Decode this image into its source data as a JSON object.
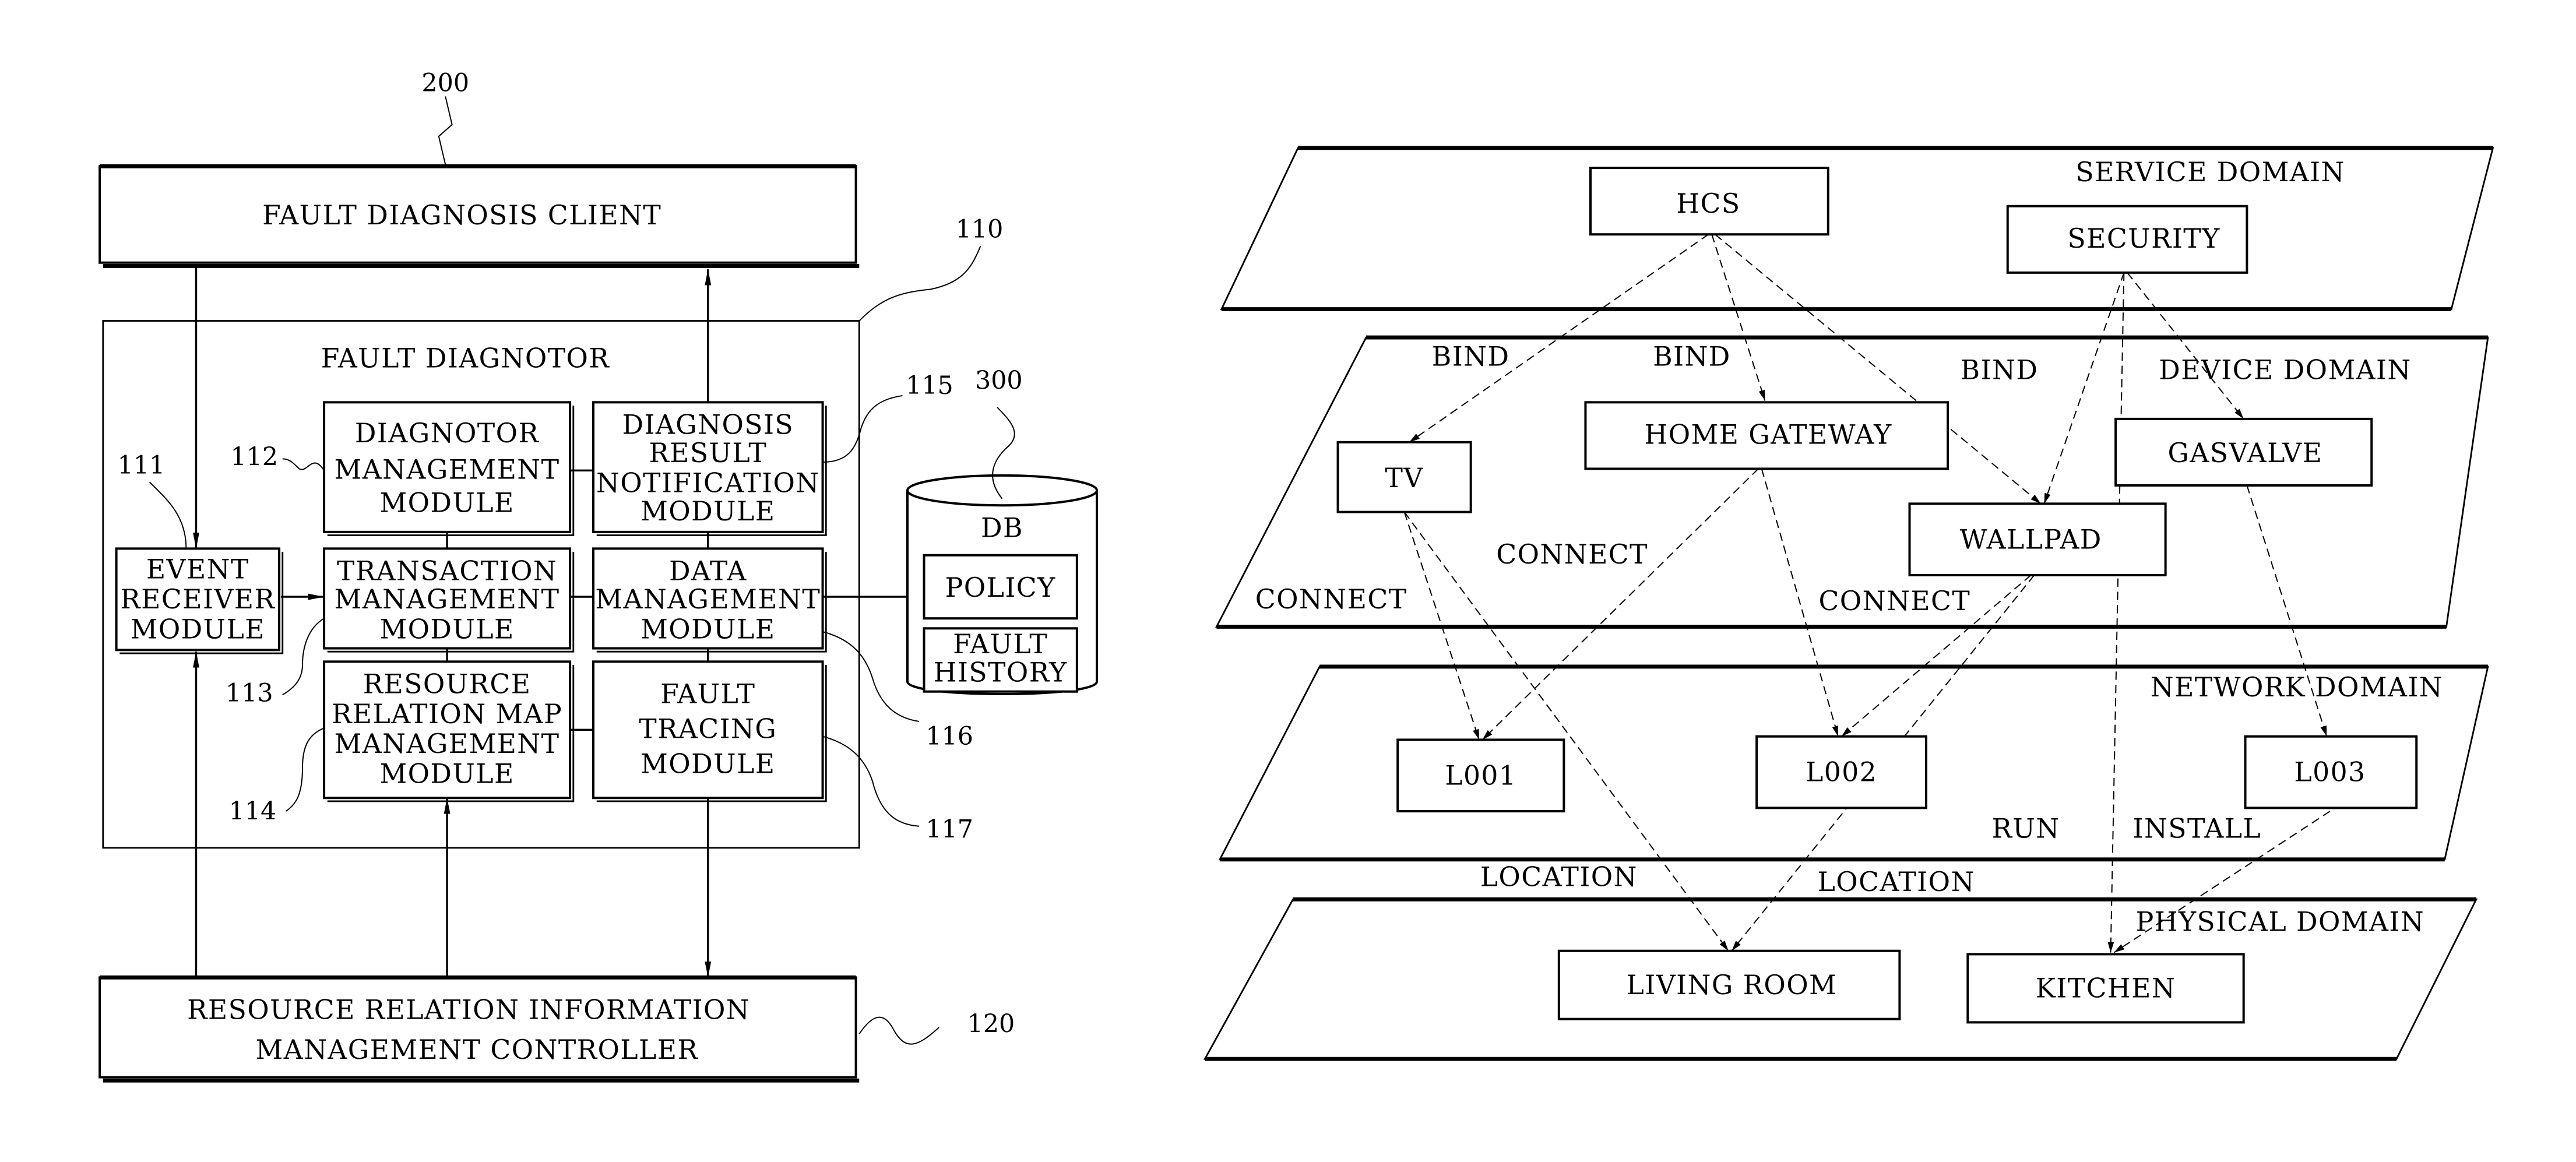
{
  "left_diagram": {
    "client": {
      "label": "FAULT DIAGNOSIS CLIENT",
      "ref": "200"
    },
    "diagnotor": {
      "label": "FAULT DIAGNOTOR",
      "ref": "110"
    },
    "modules": {
      "event_receiver": {
        "lines": [
          "EVENT",
          "RECEIVER",
          "MODULE"
        ],
        "ref": "111"
      },
      "diagnotor_management": {
        "lines": [
          "DIAGNOTOR",
          "MANAGEMENT",
          "MODULE"
        ],
        "ref": "112"
      },
      "transaction_management": {
        "lines": [
          "TRANSACTION",
          "MANAGEMENT",
          "MODULE"
        ],
        "ref": "113"
      },
      "resource_relation_map": {
        "lines": [
          "RESOURCE",
          "RELATION MAP",
          "MANAGEMENT",
          "MODULE"
        ],
        "ref": "114"
      },
      "diagnosis_result_notification": {
        "lines": [
          "DIAGNOSIS",
          "RESULT",
          "NOTIFICATION",
          "MODULE"
        ],
        "ref": "115"
      },
      "data_management": {
        "lines": [
          "DATA",
          "MANAGEMENT",
          "MODULE"
        ],
        "ref": "116"
      },
      "fault_tracing": {
        "lines": [
          "FAULT",
          "TRACING",
          "MODULE"
        ],
        "ref": "117"
      }
    },
    "db": {
      "label": "DB",
      "ref": "300",
      "policy": "POLICY",
      "fault_history": [
        "FAULT",
        "HISTORY"
      ]
    },
    "controller": {
      "lines": [
        "RESOURCE RELATION INFORMATION",
        "MANAGEMENT CONTROLLER"
      ],
      "ref": "120"
    }
  },
  "right_diagram": {
    "domains": {
      "service": "SERVICE DOMAIN",
      "device": "DEVICE DOMAIN",
      "network": "NETWORK DOMAIN",
      "physical": "PHYSICAL DOMAIN"
    },
    "nodes": {
      "hcs": "HCS",
      "security": "SECURITY",
      "tv": "TV",
      "home_gateway": "HOME GATEWAY",
      "gasvalve": "GASVALVE",
      "wallpad": "WALLPAD",
      "l001": "L001",
      "l002": "L002",
      "l003": "L003",
      "living_room": "LIVING ROOM",
      "kitchen": "KITCHEN"
    },
    "relations": {
      "bind1": "BIND",
      "bind2": "BIND",
      "bind3": "BIND",
      "connect1": "CONNECT",
      "connect2": "CONNECT",
      "connect3": "CONNECT",
      "run": "RUN",
      "install": "INSTALL",
      "location1": "LOCATION",
      "location2": "LOCATION"
    }
  }
}
